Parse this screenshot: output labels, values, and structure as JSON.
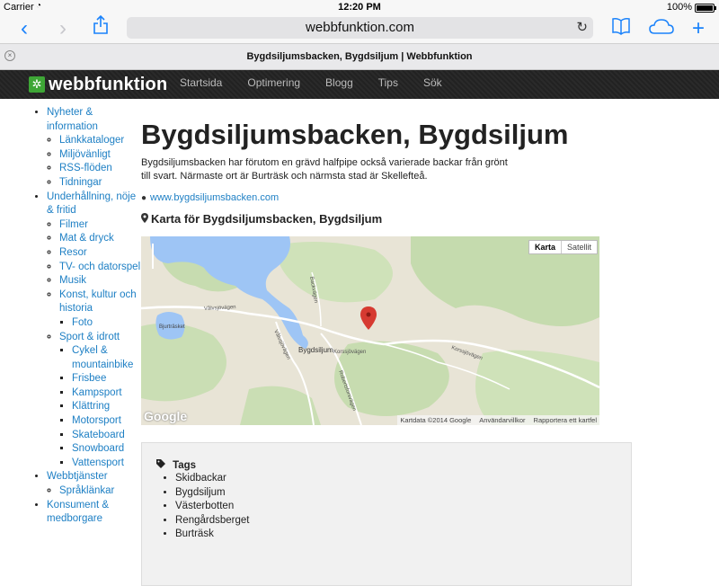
{
  "status_bar": {
    "carrier": "Carrier",
    "time": "12:20 PM",
    "battery": "100%"
  },
  "toolbar": {
    "url": "webbfunktion.com"
  },
  "tab": {
    "title": "Bygdsiljumsbacken, Bygdsiljum | Webbfunktion"
  },
  "site": {
    "logo": "webbfunktion",
    "nav": [
      "Startsida",
      "Optimering",
      "Blogg",
      "Tips",
      "Sök"
    ]
  },
  "sidebar": {
    "groups": [
      {
        "label": "Nyheter & information",
        "children": [
          {
            "label": "Länkkataloger"
          },
          {
            "label": "Miljövänligt"
          },
          {
            "label": "RSS-flöden"
          },
          {
            "label": "Tidningar"
          }
        ]
      },
      {
        "label": "Underhållning, nöje & fritid",
        "children": [
          {
            "label": "Filmer"
          },
          {
            "label": "Mat & dryck"
          },
          {
            "label": "Resor"
          },
          {
            "label": "TV- och datorspel"
          },
          {
            "label": "Musik"
          },
          {
            "label": "Konst, kultur och historia",
            "children": [
              "Foto"
            ]
          },
          {
            "label": "Sport & idrott",
            "children": [
              "Cykel & mountainbike",
              "Frisbee",
              "Kampsport",
              "Klättring",
              "Motorsport",
              "Skateboard",
              "Snowboard",
              "Vattensport"
            ]
          }
        ]
      },
      {
        "label": "Webbtjänster",
        "children": [
          {
            "label": "Språklänkar"
          }
        ]
      },
      {
        "label": "Konsument & medborgare",
        "children": []
      }
    ]
  },
  "main": {
    "title": "Bygdsiljumsbacken, Bygdsiljum",
    "description": "Bygdsiljumsbacken har förutom en grävd halfpipe också varierade backar från grönt till svart. Närmaste ort är Burträsk och närmsta stad är Skellefteå.",
    "website": "www.bygdsiljumsbacken.com",
    "map_heading": "Karta för Bygdsiljumsbacken, Bygdsiljum",
    "map": {
      "type_map": "Karta",
      "type_satellite": "Satellit",
      "attrib_data": "Kartdata ©2014 Google",
      "attrib_terms": "Användarvillkor",
      "attrib_report": "Rapportera ett kartfel",
      "google": "Google",
      "places": {
        "bygdsiljum": "Bygdsiljum",
        "lake": "Bjurträsket",
        "road1": "Vålvsjövägen",
        "road2": "Vålvsjövägen",
        "road3": "Korssjövägen",
        "road4": "Korssjövägen",
        "road5": "Robertsforsvägen",
        "road6": "Backvägen"
      }
    },
    "tags_heading": "Tags",
    "tags": [
      "Skidbackar",
      "Bygdsiljum",
      "Västerbotten",
      "Rengårdsberget",
      "Burträsk"
    ]
  }
}
